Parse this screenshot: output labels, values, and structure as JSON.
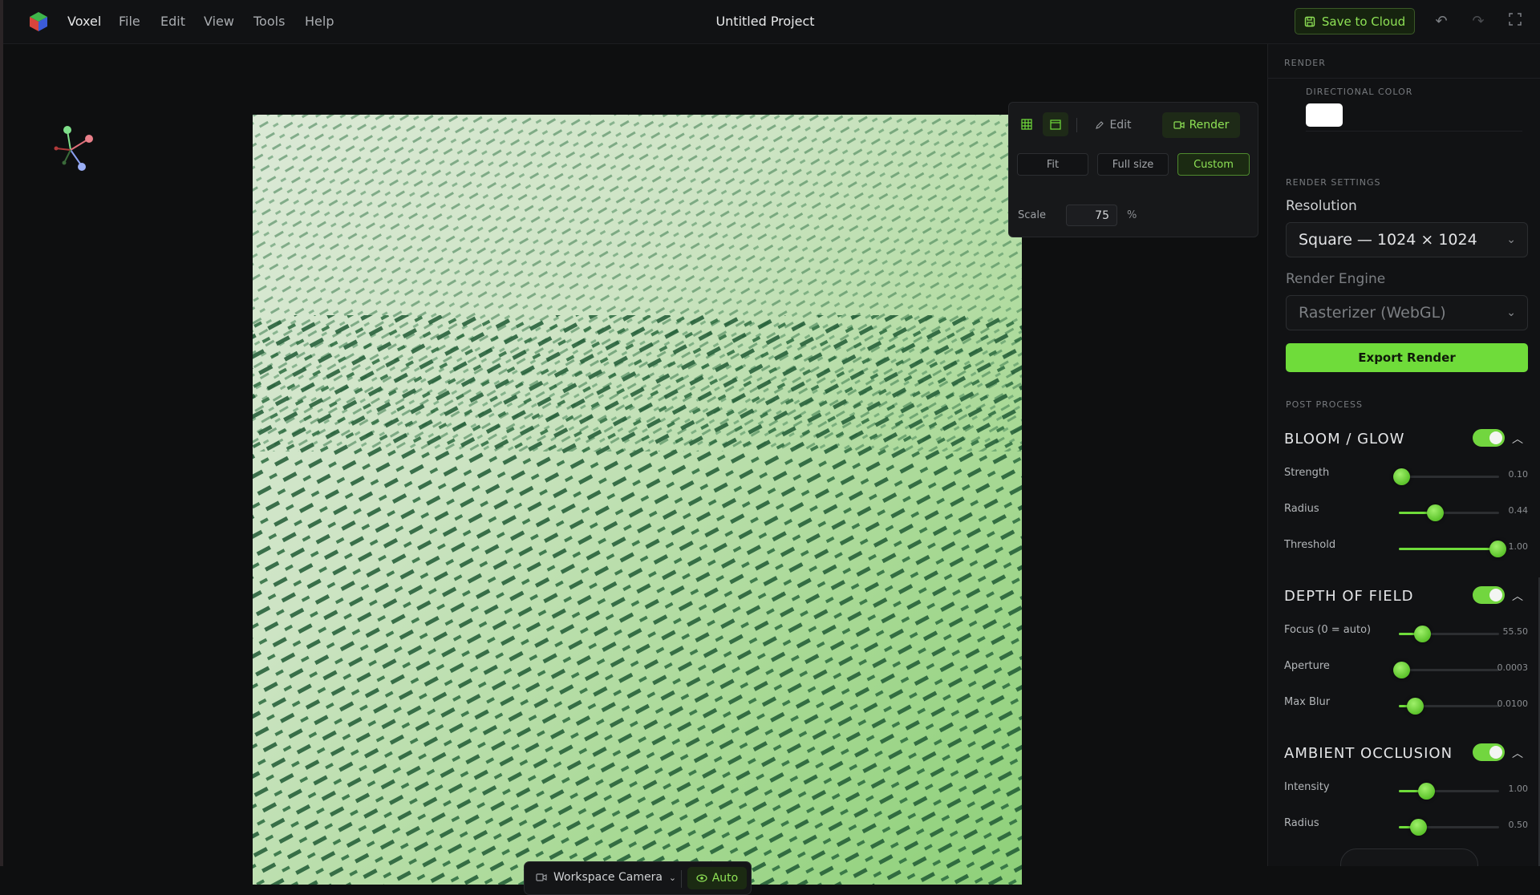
{
  "app": {
    "name": "Voxel",
    "project_title": "Untitled Project"
  },
  "menu": [
    "File",
    "Edit",
    "View",
    "Tools",
    "Help"
  ],
  "toolbar": {
    "save_label": "Save to Cloud"
  },
  "popover": {
    "tabs": {
      "edit": "Edit",
      "render": "Render"
    },
    "size_buttons": [
      "Fit",
      "Full size",
      "Custom"
    ],
    "active_size": "Custom",
    "scale_label": "Scale",
    "scale_value": "75",
    "scale_unit": "%"
  },
  "camera_bar": {
    "camera_label": "Workspace Camera",
    "auto_label": "Auto"
  },
  "panel": {
    "render_header": "RENDER",
    "directional_color_label": "DIRECTIONAL COLOR",
    "directional_color": "#ffffff",
    "render_settings_header": "RENDER SETTINGS",
    "resolution_label": "Resolution",
    "resolution_value": "Square — 1024 × 1024",
    "engine_label": "Render Engine",
    "engine_value": "Rasterizer (WebGL)",
    "export_label": "Export Render",
    "post_process_header": "POST PROCESS"
  },
  "groups": [
    {
      "title": "BLOOM / GLOW",
      "enabled": true,
      "sliders": [
        {
          "label": "Strength",
          "value": "0.10",
          "fraction": 0.02
        },
        {
          "label": "Radius",
          "value": "0.44",
          "fraction": 0.36
        },
        {
          "label": "Threshold",
          "value": "1.00",
          "fraction": 0.98
        }
      ]
    },
    {
      "title": "DEPTH OF FIELD",
      "enabled": true,
      "sliders": [
        {
          "label": "Focus (0 = auto)",
          "value": "55.50",
          "fraction": 0.23
        },
        {
          "label": "Aperture",
          "value": "0.0003",
          "fraction": 0.02
        },
        {
          "label": "Max Blur",
          "value": "0.0100",
          "fraction": 0.16
        }
      ]
    },
    {
      "title": "AMBIENT OCCLUSION",
      "enabled": true,
      "sliders": [
        {
          "label": "Intensity",
          "value": "1.00",
          "fraction": 0.27
        },
        {
          "label": "Radius",
          "value": "0.50",
          "fraction": 0.19
        }
      ]
    }
  ],
  "colors": {
    "accent": "#6fdc3a",
    "background": "#0e0f10",
    "panel": "#111214"
  }
}
